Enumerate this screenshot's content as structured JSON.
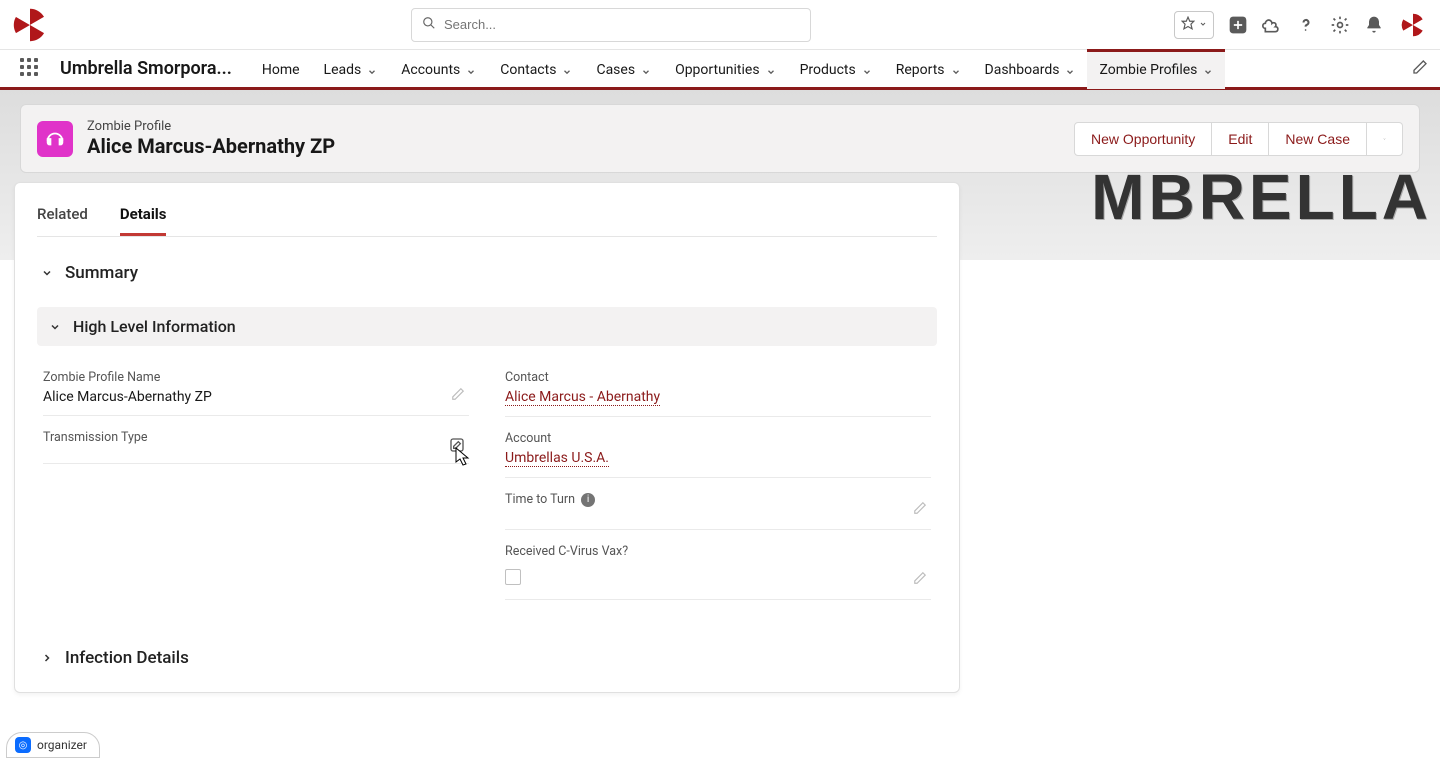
{
  "search": {
    "placeholder": "Search..."
  },
  "app_name": "Umbrella Smorpora...",
  "nav": [
    {
      "label": "Home",
      "dropdown": false
    },
    {
      "label": "Leads",
      "dropdown": true
    },
    {
      "label": "Accounts",
      "dropdown": true
    },
    {
      "label": "Contacts",
      "dropdown": true
    },
    {
      "label": "Cases",
      "dropdown": true
    },
    {
      "label": "Opportunities",
      "dropdown": true
    },
    {
      "label": "Products",
      "dropdown": true
    },
    {
      "label": "Reports",
      "dropdown": true
    },
    {
      "label": "Dashboards",
      "dropdown": true
    },
    {
      "label": "Zombie Profiles",
      "dropdown": true,
      "active": true
    }
  ],
  "banner_text": "MBRELLA",
  "record": {
    "type": "Zombie Profile",
    "name": "Alice Marcus-Abernathy ZP"
  },
  "actions": {
    "new_opportunity": "New Opportunity",
    "edit": "Edit",
    "new_case": "New Case"
  },
  "tabs": {
    "related": "Related",
    "details": "Details"
  },
  "sections": {
    "summary": "Summary",
    "high_level": "High Level Information",
    "infection": "Infection Details"
  },
  "fields": {
    "left": {
      "profile_name": {
        "label": "Zombie Profile Name",
        "value": "Alice Marcus-Abernathy ZP"
      },
      "transmission": {
        "label": "Transmission Type",
        "value": ""
      }
    },
    "right": {
      "contact": {
        "label": "Contact",
        "value": "Alice Marcus - Abernathy"
      },
      "account": {
        "label": "Account",
        "value": "Umbrellas U.S.A."
      },
      "time_turn": {
        "label": "Time to Turn",
        "value": ""
      },
      "vax": {
        "label": "Received C-Virus Vax?",
        "checked": false
      }
    }
  },
  "organizer": "organizer"
}
